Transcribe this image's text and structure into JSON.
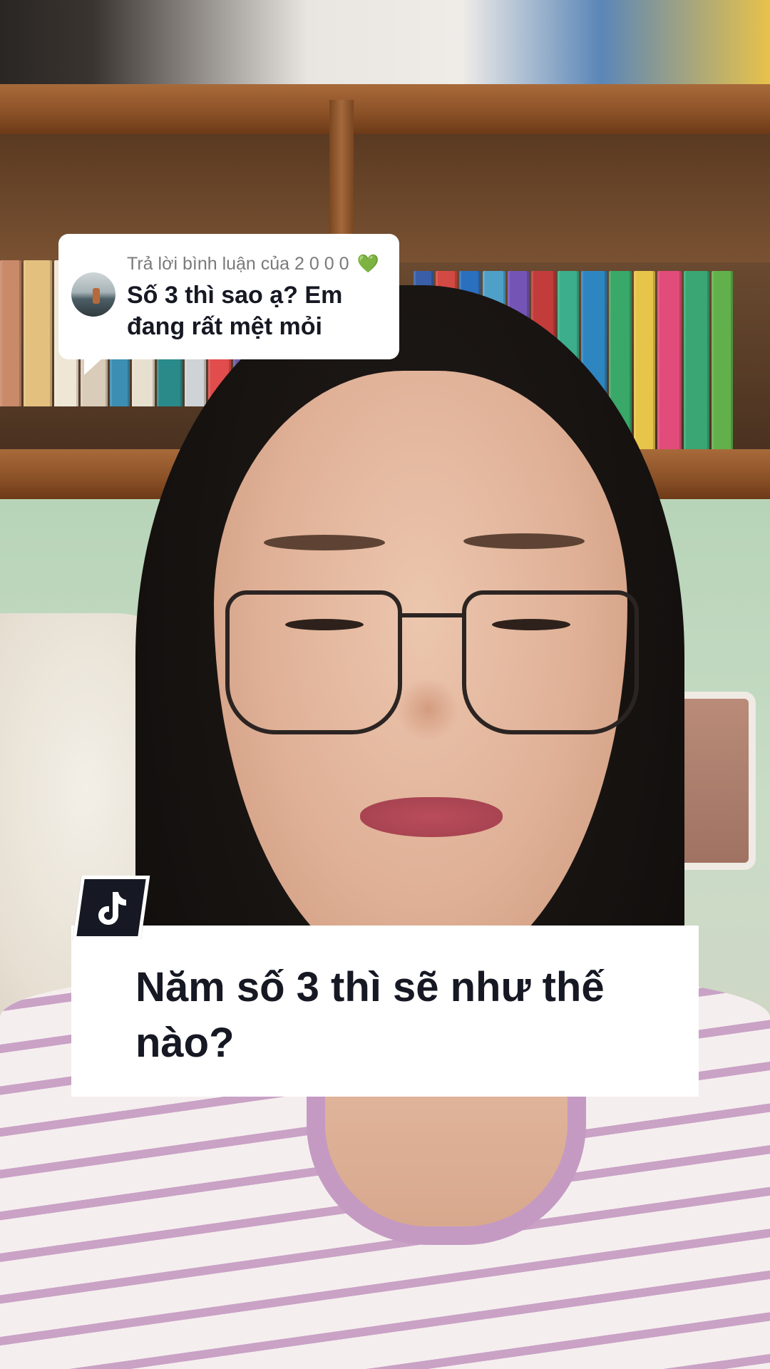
{
  "reply_card": {
    "header": "Trả lời bình luận của 2 0 0 0",
    "heart_icon": "💚",
    "comment": "Số 3 thì sao ạ? Em đang rất mệt mỏi"
  },
  "caption": {
    "text": "Năm số 3 thì sẽ như thế nào?"
  },
  "badge": {
    "icon": "tiktok-logo-icon"
  },
  "colors": {
    "caption_text": "#161823",
    "reply_header_text": "#7a7a7a",
    "heart": "#2fc25b",
    "badge_bg": "#161823"
  }
}
